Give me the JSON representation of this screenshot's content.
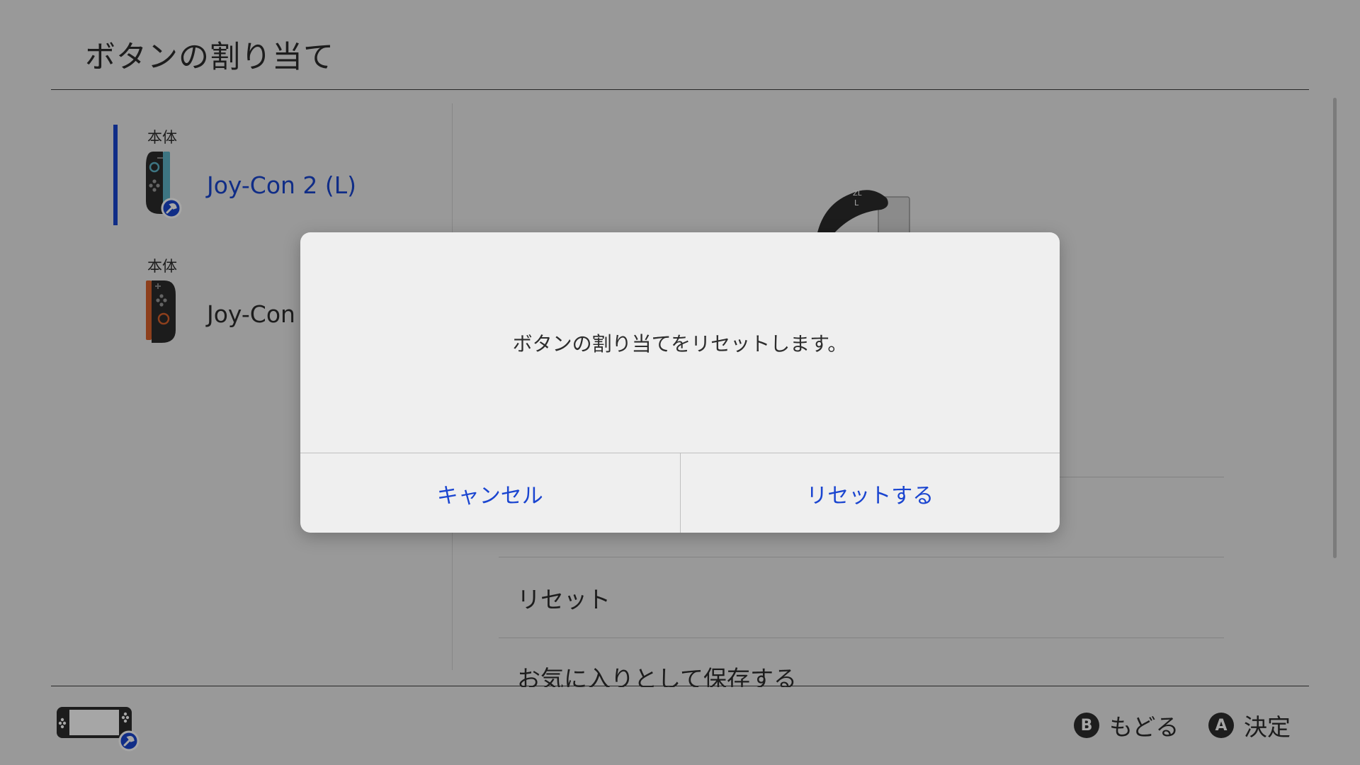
{
  "header": {
    "title": "ボタンの割り当て"
  },
  "controllers": [
    {
      "tag": "本体",
      "name": "Joy-Con 2 (L)",
      "selected": true
    },
    {
      "tag": "本体",
      "name": "Joy-Con"
    }
  ],
  "controller_art": {
    "zl": "ZL",
    "l": "L"
  },
  "menu": {
    "items": [
      "リセット",
      "お気に入りとして保存する"
    ]
  },
  "footer": {
    "back": {
      "key": "B",
      "label": "もどる"
    },
    "confirm": {
      "key": "A",
      "label": "決定"
    }
  },
  "dialog": {
    "message": "ボタンの割り当てをリセットします。",
    "cancel_label": "キャンセル",
    "reset_label": "リセットする"
  },
  "colors": {
    "accent": "#1a45d0",
    "joycon_l_accent": "#5fb4c8",
    "joycon_r_accent": "#d9622b",
    "background": "#ebebeb"
  }
}
